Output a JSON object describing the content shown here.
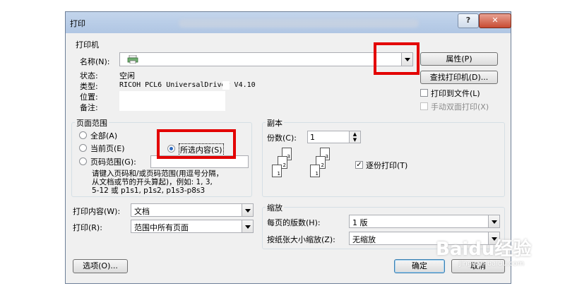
{
  "window": {
    "title": "打印",
    "help": "?",
    "close": "✕"
  },
  "printer": {
    "group_label": "打印机",
    "name_label": "名称(N):",
    "name_value": "",
    "properties_button": "属性(P)",
    "find_button": "查找打印机(D)...",
    "status_label": "状态:",
    "status_value": "空闲",
    "type_label": "类型:",
    "type_value": "RICOH PCL6 UniversalDriver V4.10",
    "location_label": "位置:",
    "comment_label": "备注:",
    "print_to_file": "打印到文件(L)",
    "manual_duplex": "手动双面打印(X)"
  },
  "page_range": {
    "group_label": "页面范围",
    "all": "全部(A)",
    "current": "当前页(E)",
    "selection": "所选内容(S)",
    "pages": "页码范围(G):",
    "pages_value": "",
    "hint": [
      "请键入页码和/或页码范围(用逗号分隔，",
      "从文档或节的开头算起)，例如: 1, 3,",
      "5-12 或 p1s1, p1s2, p1s3-p8s3"
    ]
  },
  "copies": {
    "group_label": "副本",
    "count_label": "份数(C):",
    "count_value": "1",
    "collate": "逐份打印(T)",
    "collate_checked": true
  },
  "print_what": {
    "label": "打印内容(W):",
    "value": "文档"
  },
  "print": {
    "label": "打印(R):",
    "value": "范围中所有页面"
  },
  "zoom": {
    "group_label": "缩放",
    "pages_per_sheet_label": "每页的版数(H):",
    "pages_per_sheet_value": "1 版",
    "scale_label": "按纸张大小缩放(Z):",
    "scale_value": "无缩放"
  },
  "footer": {
    "options": "选项(O)...",
    "ok": "确定",
    "cancel": "取消"
  },
  "watermark": {
    "brand": "Baidu经验",
    "sub": "jingyan.baidu.com"
  },
  "colors": {
    "highlight_box": "#e30000",
    "title_bar": "#b0c6e3",
    "face": "#f0f0f0"
  }
}
